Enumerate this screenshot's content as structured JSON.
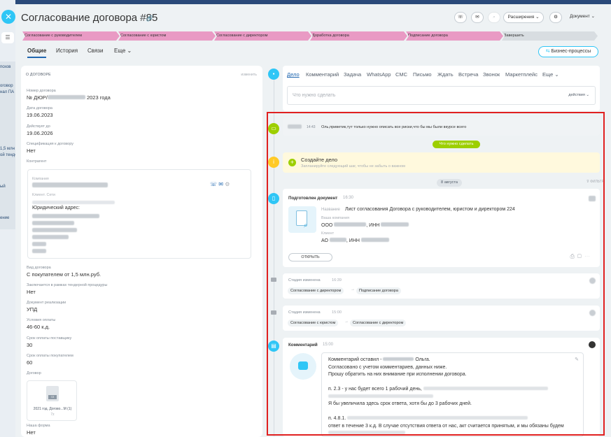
{
  "page": {
    "title": "Согласование договора #85"
  },
  "background": {
    "sidebar_texts": [
      "псков",
      "",
      "",
      "оговор",
      "нал ПА",
      "",
      "",
      "",
      "",
      "",
      "",
      "",
      "",
      "1,5 млн",
      "ой тенде",
      "",
      "",
      "",
      "",
      "ый",
      "",
      "",
      "",
      "",
      "ение"
    ]
  },
  "header": {
    "buttons": [
      {
        "label": "Расширения",
        "icon": "chevron-down-icon"
      },
      {
        "label": "Документ",
        "icon": "chevron-down-icon"
      }
    ]
  },
  "stages": [
    {
      "label": "Согласование с руководителем",
      "color": "#e99ac4"
    },
    {
      "label": "Согласование с юристом",
      "color": "#e99ac4"
    },
    {
      "label": "Согласование с директором",
      "color": "#e99ac4"
    },
    {
      "label": "Доработка договора",
      "color": "#e99ac4"
    },
    {
      "label": "Подписание договора",
      "color": "#e99ac4"
    },
    {
      "label": "Завершить",
      "color": "#d8dde1"
    }
  ],
  "tabs": [
    "Общие",
    "История",
    "Связи",
    "Еще"
  ],
  "business_processes": "Бизнес-процессы",
  "left": {
    "section_title": "О ДОГОВОРЕ",
    "section_edit": "изменить",
    "fields": [
      {
        "label": "Номер договора",
        "value": "№ ДЮР/",
        "value_tail": " 2023 года"
      },
      {
        "label": "Дата договора",
        "value": "19.06.2023"
      },
      {
        "label": "Действует до",
        "value": "19.06.2026"
      },
      {
        "label": "Спецификация к договору",
        "value": "Нет"
      },
      {
        "label": "Контрагент",
        "value": ""
      }
    ],
    "contractor": {
      "company_label": "Компания",
      "client_label": "Клиент. Сети",
      "address_label": "Юридический адрес:"
    },
    "fields2": [
      {
        "label": "Вид договора",
        "value": "С покупателем от 1,5 млн.руб."
      },
      {
        "label": "Заключается в рамках тендерной процедуры",
        "value": "Нет"
      },
      {
        "label": "Документ реализации",
        "value": "УПД"
      },
      {
        "label": "Условия оплаты",
        "value": "46-60 к.д."
      },
      {
        "label": "Срок оплаты поставщику",
        "value": "30"
      },
      {
        "label": "Срок оплаты покупателем",
        "value": "60"
      },
      {
        "label": "Договор",
        "value": ""
      }
    ],
    "doc_file": {
      "name": "2021 год. Догово...М (1)",
      "ext": "7z",
      "badge": "7Z"
    },
    "fields3": [
      {
        "label": "Наша форма",
        "value": "Нет"
      }
    ]
  },
  "editor": {
    "tabs": [
      "Дело",
      "Комментарий",
      "Задача",
      "WhatsApp",
      "СМС",
      "Письмо",
      "Ждать",
      "Встреча",
      "Звонок",
      "Маркетплейс",
      "Еще"
    ],
    "placeholder": "Что нужно сделать",
    "actions": "действия"
  },
  "timeline": {
    "message": {
      "time": "14:43",
      "text": "Оль,приветик,тут только нужно описать все риски,что бы мы были вкурсе всего"
    },
    "todo_pill": "Что нужно сделать",
    "create_task": {
      "title": "Создайте дело",
      "subtitle": "Запланируйте следующий шаг, чтобы не забыть о важном"
    },
    "date_pill": "8 августа",
    "filter": "ФИЛЬТР",
    "doc": {
      "title": "Подготовлен документ",
      "time": "16:30",
      "name_label": "Название",
      "name_value": "Лист согласования Договора с руководителем, юристом и директором 224",
      "company_label": "Ваша компания",
      "company_value": "ООО ",
      "company_inn": ", ИНН ",
      "client_label": "Клиент",
      "client_value": "АО ",
      "client_inn": ", ИНН ",
      "open_button": "ОТКРЫТЬ"
    },
    "stage1": {
      "title": "Стадия изменена",
      "time": "16:39",
      "from": "Согласование с директором",
      "to": "Подписание договора"
    },
    "stage2": {
      "title": "Стадия изменена",
      "time": "15:00",
      "from": "Согласование с юристом",
      "to": "Согласование с директором"
    },
    "comment": {
      "title": "Комментарий",
      "time": "15:00",
      "lines": [
        "Комментарий оставил - ",
        "Согласовано с учетом комментариев, данных ниже.",
        "Прошу обратить на них внимание при исполнении договора.",
        "п. 2.3 - у нас будет всего 1 рабочий день,",
        "Я бы увеличила здесь срок ответа, хотя бы до 3 рабочих дней.",
        "п. 4.8.1.",
        "ответ в течение 3 к.д. В случае отсутствия ответа от нас, акт считается принятым, и мы обязаны будем"
      ],
      "author_tail": "Ольга."
    }
  }
}
